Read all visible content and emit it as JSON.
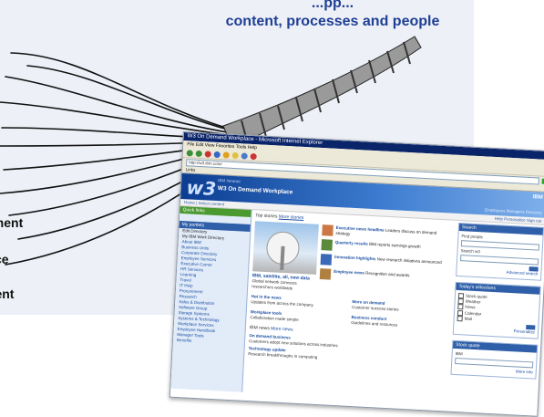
{
  "slide": {
    "caption_top": [
      "...pp...",
      "content, processes and people"
    ],
    "side_labels": [
      "ement",
      "ce",
      "ment"
    ]
  },
  "window": {
    "title": "W3 On Demand Workplace - Microsoft Internet Explorer",
    "menu": "File  Edit  View  Favorites  Tools  Help",
    "address": "http://w3.ibm.com/",
    "links": "Links",
    "banner": {
      "logo": "w3",
      "top_small": "IBM Intranet",
      "portal_name": "W3 On Demand Workplace",
      "brand": "IBM",
      "nav": "Employees   Managers   Directory"
    },
    "subbar_left": "Home  | Select content",
    "subbar_right": "Help   Personalize   Sign out",
    "left_nav": {
      "header": "Quick links",
      "header2": "My portlets",
      "items": [
        "Edit Directory",
        "My IBM Work Directory",
        "About IBM",
        "Business Units",
        "Corporate Directory",
        "Employee Services",
        "Executive Corner",
        "HR Services",
        "Learning",
        "Travel",
        "IT Help",
        "Procurement",
        "Research",
        "Sales & Distribution",
        "Software Group",
        "Storage Systems",
        "Systems & Technology",
        "Workplace Services",
        "Employee Handbook",
        "Manager Tools",
        "Benefits"
      ]
    },
    "main": {
      "tabs_label": "Top stories",
      "tabs_link": "More stories",
      "feature_caption": "IBM, satellite, all, new data",
      "feature_text": "Global network connects researchers worldwide",
      "stories": [
        {
          "title": "Executive news headline",
          "text": "Leaders discuss on demand strategy"
        },
        {
          "title": "Quarterly results",
          "text": "IBM reports earnings growth"
        },
        {
          "title": "Innovation highlights",
          "text": "New research initiatives announced"
        },
        {
          "title": "Employee news",
          "text": "Recognition and awards"
        }
      ],
      "grid": [
        {
          "title": "Hot in the news",
          "text": "Updates from across the company"
        },
        {
          "title": "More on demand",
          "text": "Customer success stories"
        },
        {
          "title": "Workplace tools",
          "text": "Collaboration made simple"
        },
        {
          "title": "Business conduct",
          "text": "Guidelines and resources"
        }
      ],
      "topnews_label": "IBM news",
      "topnews_link": "More news",
      "news": [
        {
          "title": "On demand business",
          "text": "Customers adopt new solutions across industries"
        },
        {
          "title": "Technology update",
          "text": "Research breakthroughs in computing"
        }
      ]
    },
    "right": {
      "box1_title": "Search",
      "box1_labels": [
        "Find people",
        "Search w3"
      ],
      "box1_link": "Advanced search",
      "box2_title": "Today's selections",
      "box2_items": [
        "Stock quote",
        "Weather",
        "News",
        "Calendar",
        "Mail"
      ],
      "box2_link": "Personalize",
      "box3_title": "Stock quote",
      "box3_text": "IBM",
      "box3_link": "More info"
    }
  }
}
